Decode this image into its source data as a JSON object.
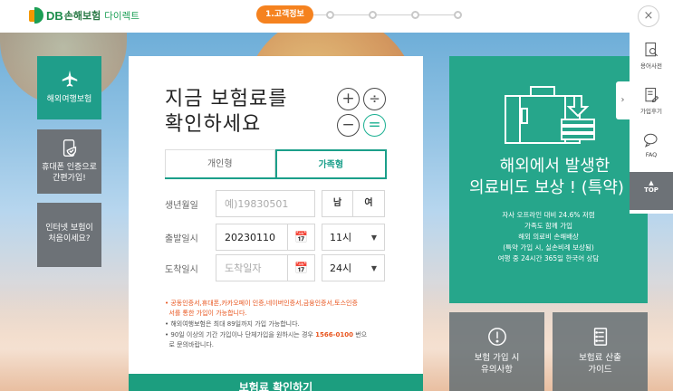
{
  "header": {
    "logo_db": "DB",
    "logo_ko": "손해보험",
    "logo_direct": "다이렉트",
    "active_step": "1.고객정보",
    "close_symbol": "×"
  },
  "left_menu": {
    "travel": "해외여행보험",
    "phone_line1": "휴대폰 인증으로",
    "phone_line2": "간편가입!",
    "first_line1": "인터넷 보험이",
    "first_line2": "처음이세요?"
  },
  "form": {
    "title_line1": "지금 보험료를",
    "title_line2": "확인하세요",
    "tabs": [
      "개인형",
      "가족형"
    ],
    "birth_label": "생년월일",
    "birth_placeholder": "예)19830501",
    "gender_male": "남",
    "gender_female": "여",
    "depart_label": "출발일시",
    "depart_date": "20230110",
    "depart_time": "11시",
    "arrive_label": "도착일시",
    "arrive_placeholder": "도착일자",
    "arrive_time": "24시",
    "note1": "공동인증서,휴대폰,카카오페이 인증,네이버인증서,금융인증서,토스인증",
    "note1b": "서를 통한 가입이 가능합니다.",
    "note2": "해외여행보험은 최대 89일까지 가입 가능합니다.",
    "note3_a": "90일 이상의 기간 가입이나 단체가입을 원하시는 경우",
    "note3_phone": "1566-0100",
    "note3_b": "번으",
    "note3_c": "로 문의바랍니다.",
    "cta": "보험료 확인하기"
  },
  "promo": {
    "title_line1": "해외에서 발생한",
    "title_line2": "의료비도 보상 ! (특약)",
    "desc": [
      "자사 오프라인 대비 24.6% 저렴",
      "가족도 함께 가입",
      "해외 의료비 손해배상",
      "(특약 가입 시, 실손비례 보상됨)",
      "여행 중 24시간 365일 한국어 상담"
    ]
  },
  "tiles": {
    "caution_line1": "보험 가입 시",
    "caution_line2": "유의사항",
    "guide_line1": "보험료 산출",
    "guide_line2": "가이드"
  },
  "rail": {
    "glossary": "용어사전",
    "review": "가입후기",
    "faq": "FAQ",
    "top": "TOP",
    "toggle": "›"
  },
  "colors": {
    "brand_green": "#1b9f55",
    "accent_orange": "#f5821f",
    "teal": "#26a68b",
    "gray_tile": "#6d7277"
  }
}
